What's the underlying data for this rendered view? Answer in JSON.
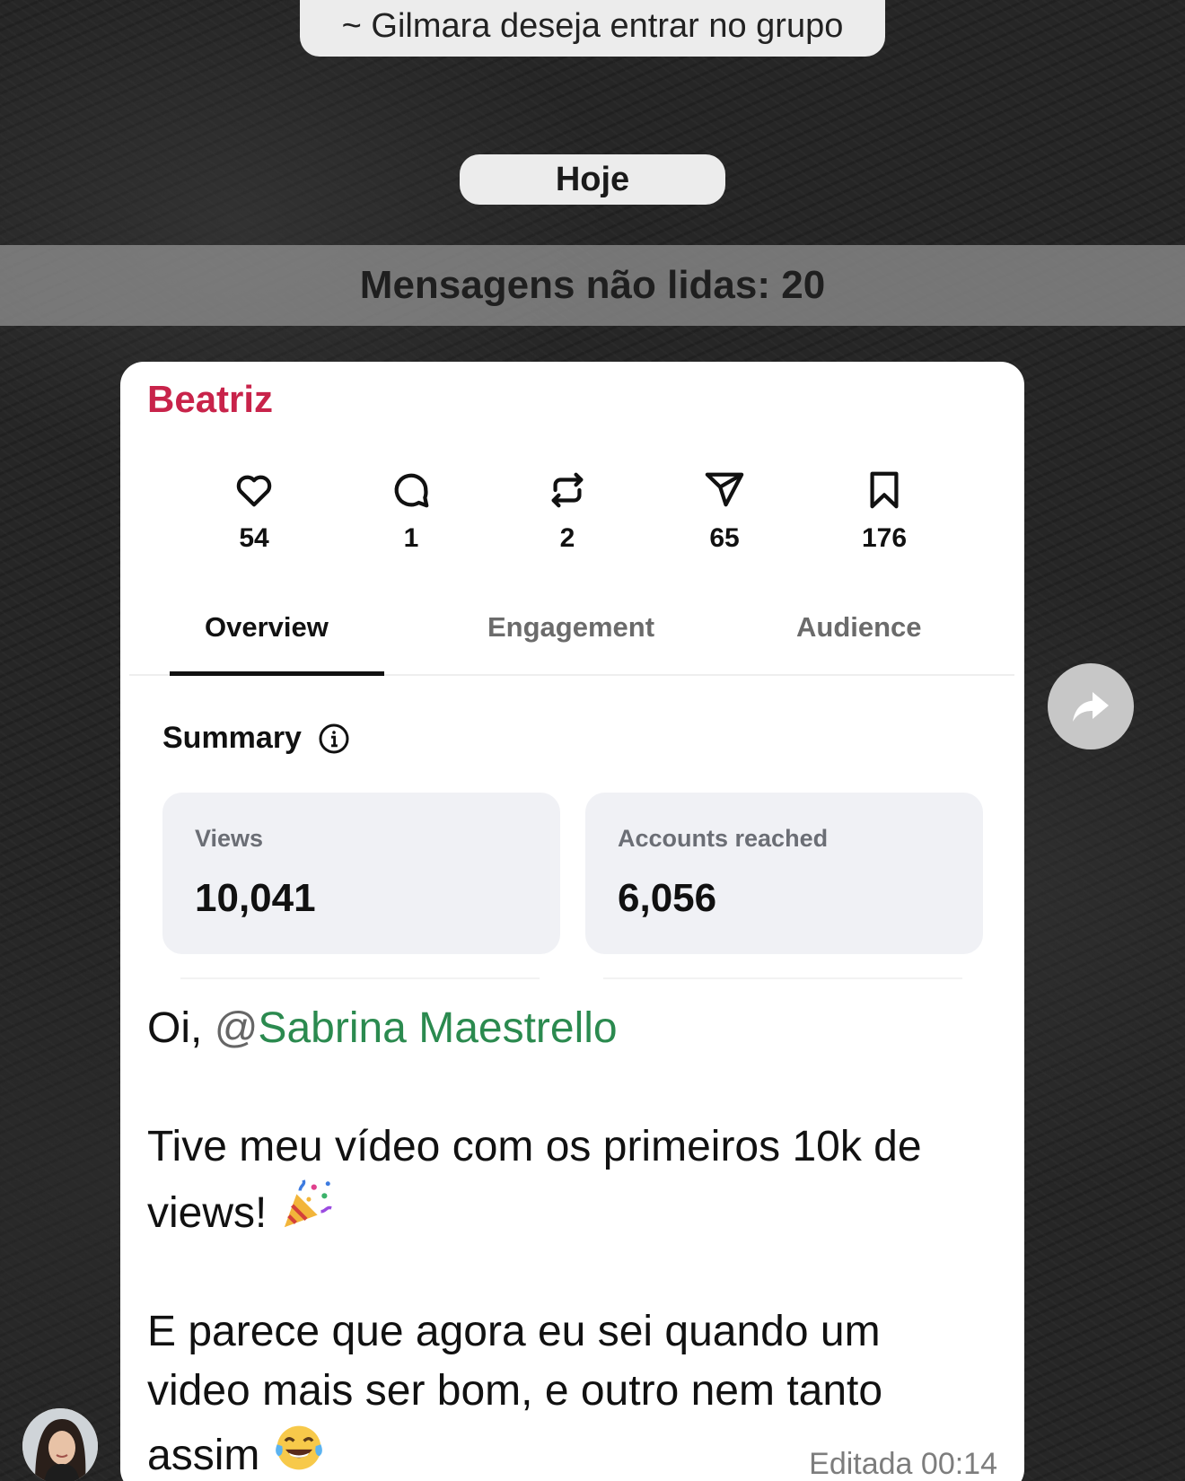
{
  "system_message": "~ Gilmara deseja entrar no grupo",
  "date_divider": "Hoje",
  "unread_banner": "Mensagens não lidas: 20",
  "message": {
    "sender": "Beatriz",
    "sender_color": "#c8234a",
    "screenshot": {
      "stats": [
        {
          "icon": "heart-icon",
          "value": "54"
        },
        {
          "icon": "comment-icon",
          "value": "1"
        },
        {
          "icon": "repost-icon",
          "value": "2"
        },
        {
          "icon": "send-icon",
          "value": "65"
        },
        {
          "icon": "bookmark-icon",
          "value": "176"
        }
      ],
      "tabs": [
        "Overview",
        "Engagement",
        "Audience"
      ],
      "active_tab": "Overview",
      "summary_title": "Summary",
      "cards": [
        {
          "label": "Views",
          "value": "10,041"
        },
        {
          "label": "Accounts reached",
          "value": "6,056"
        }
      ]
    },
    "greeting": "Oi,",
    "mention_at": "@",
    "mention_name": "Sabrina Maestrello",
    "mention_color": "#2b8a4f",
    "paragraph_1": "Tive meu vídeo com os primeiros 10k de views!",
    "paragraph_1_emoji": "party-popper-icon",
    "paragraph_2": "E parece que agora eu sei quando um video mais ser bom, e outro nem tanto assim",
    "paragraph_2_emoji": "tears-of-joy-icon",
    "edited_label": "Editada 00:14"
  },
  "forward_button_icon": "forward-arrow-icon"
}
